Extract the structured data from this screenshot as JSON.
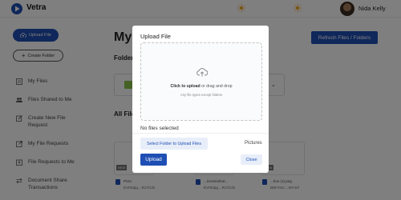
{
  "app": {
    "brand": "Vetra"
  },
  "header": {
    "user_name": "Nida Kelly"
  },
  "sidebar": {
    "upload_label": "Upload File",
    "create_folder_label": "Create Folder",
    "items": [
      {
        "label": "My Files",
        "icon": "list-icon"
      },
      {
        "label": "Files Shared to Me",
        "icon": "users-icon"
      },
      {
        "label": "Create New File Request",
        "icon": "edit-icon"
      },
      {
        "label": "My File Requests",
        "icon": "external-link-icon"
      },
      {
        "label": "File Requests to Me",
        "icon": "inbox-icon"
      },
      {
        "label": "Document Share Transactions",
        "icon": "swap-icon"
      }
    ]
  },
  "main": {
    "title": "My",
    "refresh_label": "Refresh Files / Folders",
    "folders_heading": "Folder",
    "all_files_heading": "All File",
    "files": [
      {
        "tag": "NEW",
        "name": "Pictu",
        "meta": "EVIS0pg....R17Cdo"
      },
      {
        "tag": "NEW",
        "name": "...Screenshot...",
        "meta": "EVIS0pg....R17Cdo"
      },
      {
        "tag": "NEW",
        "name": "...hon (1).png",
        "meta": "BNFVSo....WYJnf"
      }
    ]
  },
  "modal": {
    "title": "Upload File",
    "drop_click": "Click to upload",
    "drop_rest": " or drag and drop",
    "drop_sub": "Any file types except folders",
    "no_files": "No files selected",
    "select_folder_label": "Select Folder to Upload Files",
    "folder_name": "Pictures",
    "upload_label": "Upload",
    "close_label": "Close"
  },
  "colors": {
    "accent": "#1f4fb4",
    "overlay": "rgba(0,0,0,0.5)"
  }
}
